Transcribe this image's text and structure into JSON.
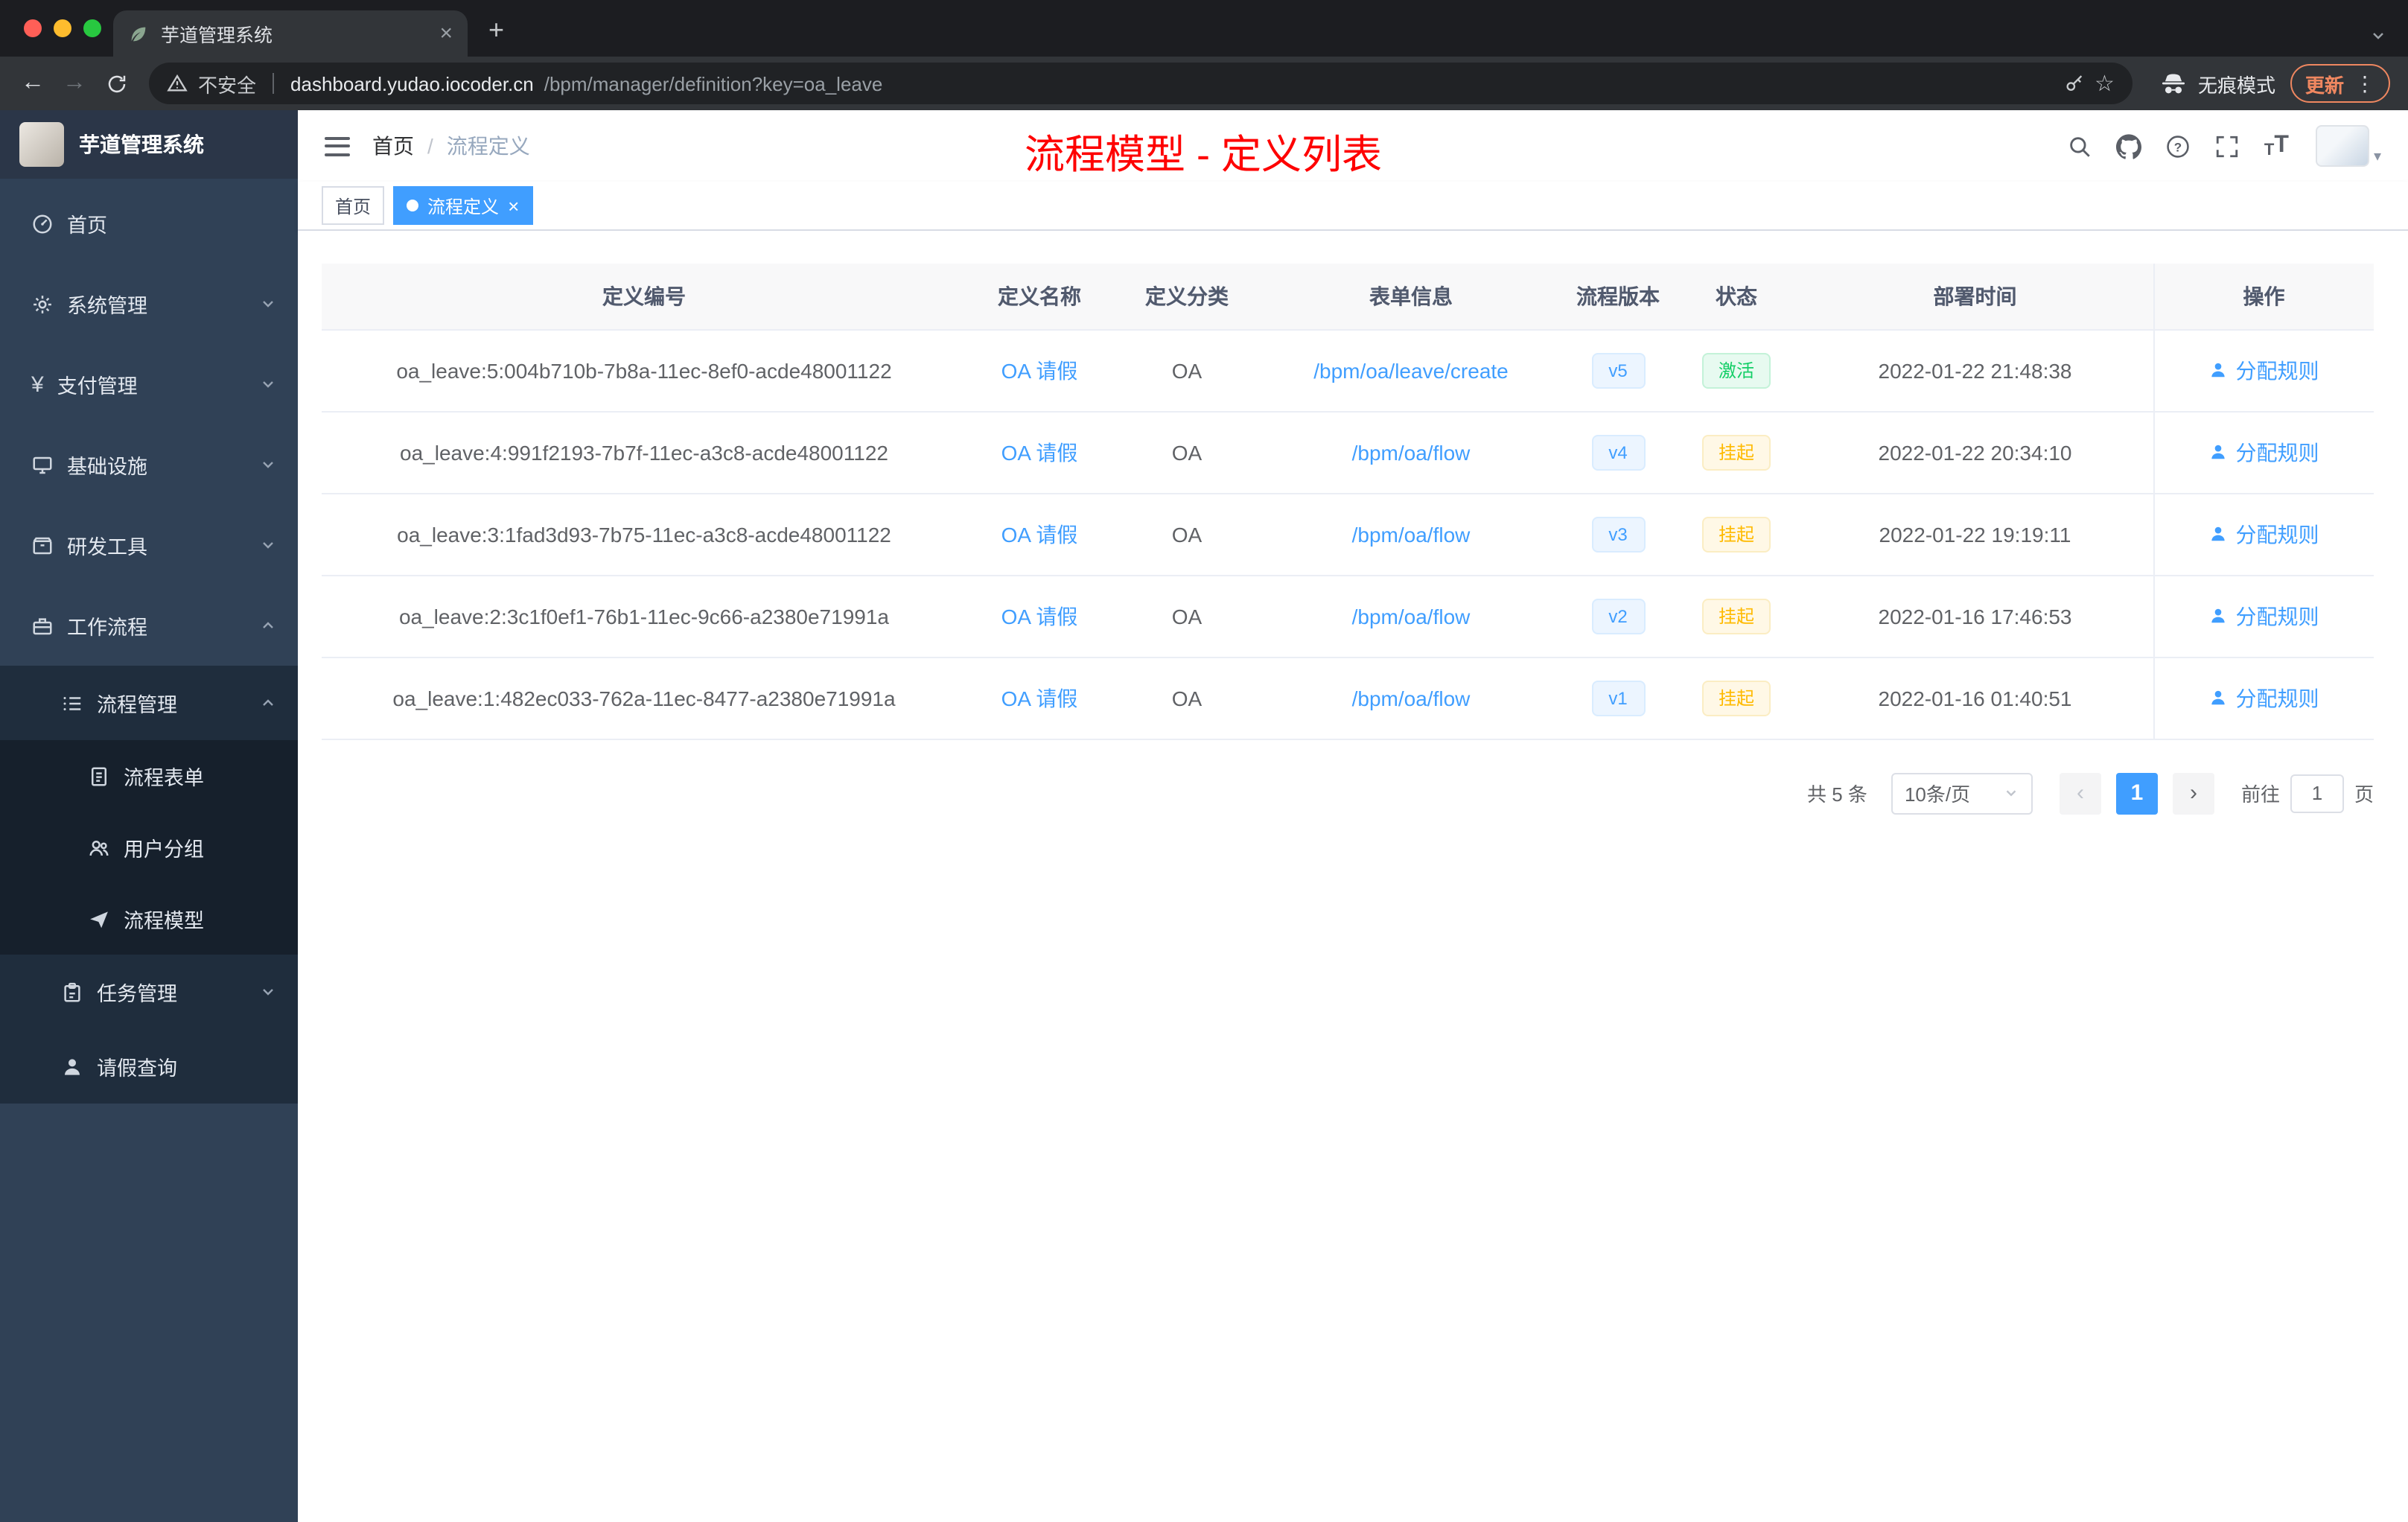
{
  "colors": {
    "accent": "#409eff",
    "annotation": "#fe0000",
    "success": "#13ce66",
    "warning": "#ffba00",
    "update": "#ef8760"
  },
  "browser": {
    "tab_title": "芋道管理系统",
    "security_label": "不安全",
    "url_host": "dashboard.yudao.iocoder.cn",
    "url_path": "/bpm/manager/definition?key=oa_leave",
    "incognito_label": "无痕模式",
    "update_label": "更新"
  },
  "sidebar": {
    "app_title": "芋道管理系统",
    "items": [
      {
        "label": "首页"
      },
      {
        "label": "系统管理"
      },
      {
        "label": "支付管理"
      },
      {
        "label": "基础设施"
      },
      {
        "label": "研发工具"
      },
      {
        "label": "工作流程"
      },
      {
        "label": "流程管理"
      },
      {
        "label": "流程表单"
      },
      {
        "label": "用户分组"
      },
      {
        "label": "流程模型"
      },
      {
        "label": "任务管理"
      },
      {
        "label": "请假查询"
      }
    ]
  },
  "header": {
    "breadcrumb_home": "首页",
    "breadcrumb_separator": "/",
    "breadcrumb_current": "流程定义",
    "annotation": "流程模型 - 定义列表"
  },
  "tags": {
    "home": "首页",
    "active": "流程定义"
  },
  "table": {
    "columns": [
      "定义编号",
      "定义名称",
      "定义分类",
      "表单信息",
      "流程版本",
      "状态",
      "部署时间",
      "操作"
    ],
    "rows": [
      {
        "id": "oa_leave:5:004b710b-7b8a-11ec-8ef0-acde48001122",
        "name": "OA 请假",
        "category": "OA",
        "form": "/bpm/oa/leave/create",
        "version": "v5",
        "status": "激活",
        "status_type": "success",
        "time": "2022-01-22 21:48:38",
        "action": "分配规则"
      },
      {
        "id": "oa_leave:4:991f2193-7b7f-11ec-a3c8-acde48001122",
        "name": "OA 请假",
        "category": "OA",
        "form": "/bpm/oa/flow",
        "version": "v4",
        "status": "挂起",
        "status_type": "warning",
        "time": "2022-01-22 20:34:10",
        "action": "分配规则"
      },
      {
        "id": "oa_leave:3:1fad3d93-7b75-11ec-a3c8-acde48001122",
        "name": "OA 请假",
        "category": "OA",
        "form": "/bpm/oa/flow",
        "version": "v3",
        "status": "挂起",
        "status_type": "warning",
        "time": "2022-01-22 19:19:11",
        "action": "分配规则"
      },
      {
        "id": "oa_leave:2:3c1f0ef1-76b1-11ec-9c66-a2380e71991a",
        "name": "OA 请假",
        "category": "OA",
        "form": "/bpm/oa/flow",
        "version": "v2",
        "status": "挂起",
        "status_type": "warning",
        "time": "2022-01-16 17:46:53",
        "action": "分配规则"
      },
      {
        "id": "oa_leave:1:482ec033-762a-11ec-8477-a2380e71991a",
        "name": "OA 请假",
        "category": "OA",
        "form": "/bpm/oa/flow",
        "version": "v1",
        "status": "挂起",
        "status_type": "warning",
        "time": "2022-01-16 01:40:51",
        "action": "分配规则"
      }
    ]
  },
  "pagination": {
    "total": "共 5 条",
    "page_size": "10条/页",
    "page": "1",
    "goto_label": "前往",
    "goto_value": "1",
    "page_unit": "页"
  }
}
